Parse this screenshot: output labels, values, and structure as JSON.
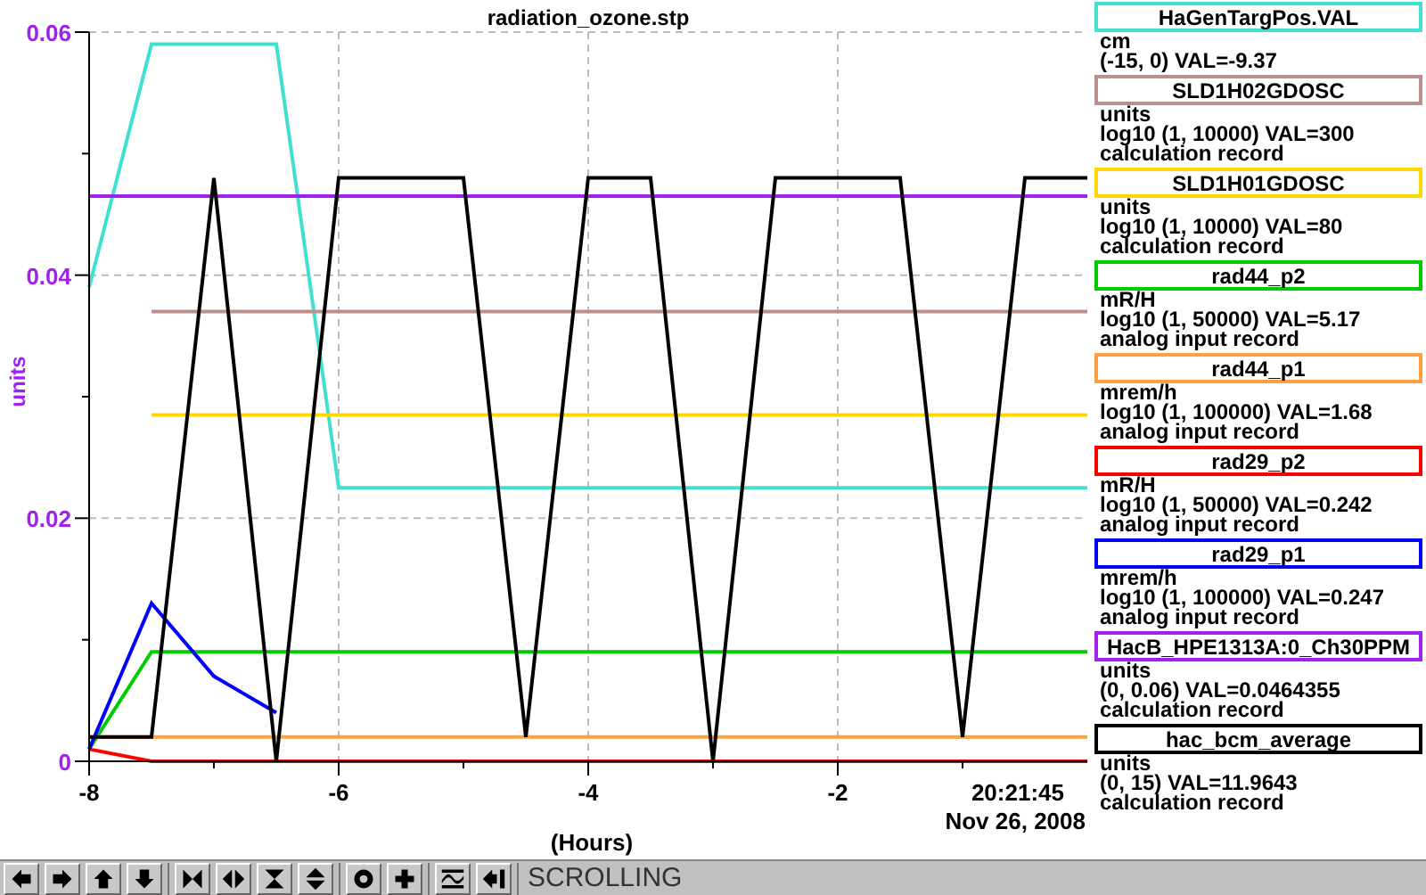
{
  "plot": {
    "time_label": "20:21:45",
    "date_label": "Nov 26, 2008",
    "chart_data": {
      "type": "line",
      "title": "radiation_ozone.stp",
      "xlabel": "(Hours)",
      "ylabel": "units",
      "x": [
        -8,
        -7.5,
        -7,
        -6.5,
        -6,
        -5.5,
        -5,
        -4.5,
        -4,
        -3.5,
        -3,
        -2.5,
        -2,
        -1.5,
        -1,
        -0.5,
        0
      ],
      "grid": true,
      "xlim": [
        -8,
        0
      ],
      "ylim": [
        0,
        0.06
      ],
      "xticks": [
        -8,
        -6,
        -4,
        -2
      ],
      "yticks": [
        0,
        0.02,
        0.04,
        0.06
      ],
      "series": [
        {
          "name": "HaGenTargPos.VAL",
          "color": "#40e0d0",
          "values": [
            0.039,
            0.059,
            0.059,
            0.059,
            0.0225,
            0.0225,
            0.0225,
            0.0225,
            0.0225,
            0.0225,
            0.0225,
            0.0225,
            0.0225,
            0.0225,
            0.0225,
            0.0225,
            0.0225
          ]
        },
        {
          "name": "SLD1H02GDOSC",
          "color": "#bc8f8f",
          "values": [
            null,
            0.037,
            0.037,
            0.037,
            0.037,
            0.037,
            0.037,
            0.037,
            0.037,
            0.037,
            0.037,
            0.037,
            0.037,
            0.037,
            0.037,
            0.037,
            0.037
          ]
        },
        {
          "name": "SLD1H01GDOSC",
          "color": "#ffd700",
          "values": [
            null,
            0.0285,
            0.0285,
            0.0285,
            0.0285,
            0.0285,
            0.0285,
            0.0285,
            0.0285,
            0.0285,
            0.0285,
            0.0285,
            0.0285,
            0.0285,
            0.0285,
            0.0285,
            0.0285
          ]
        },
        {
          "name": "rad44_p2",
          "color": "#00cd00",
          "values": [
            0.001,
            0.009,
            0.009,
            0.009,
            0.009,
            0.009,
            0.009,
            0.009,
            0.009,
            0.009,
            0.009,
            0.009,
            0.009,
            0.009,
            0.009,
            0.009,
            0.009
          ]
        },
        {
          "name": "rad44_p1",
          "color": "#ffa040",
          "values": [
            0.002,
            0.002,
            0.002,
            0.002,
            0.002,
            0.002,
            0.002,
            0.002,
            0.002,
            0.002,
            0.002,
            0.002,
            0.002,
            0.002,
            0.002,
            0.002,
            0.002
          ]
        },
        {
          "name": "rad29_p2",
          "color": "#ff0000",
          "values": [
            0.001,
            0,
            0,
            0,
            0,
            0,
            0,
            0,
            0,
            0,
            0,
            0,
            0,
            0,
            0,
            0,
            0
          ]
        },
        {
          "name": "rad29_p1",
          "color": "#0000ff",
          "values": [
            0.001,
            0.013,
            0.007,
            0.004,
            null,
            null,
            null,
            null,
            null,
            null,
            null,
            null,
            null,
            null,
            null,
            null,
            null
          ]
        },
        {
          "name": "HacB_HPE1313A:0_Ch30PPM",
          "color": "#a020f0",
          "values": [
            0.0465,
            0.0465,
            0.0465,
            0.0465,
            0.0465,
            0.0465,
            0.0465,
            0.0465,
            0.0465,
            0.0465,
            0.0465,
            0.0465,
            0.0465,
            0.0465,
            0.0465,
            0.0465,
            0.0465
          ]
        },
        {
          "name": "hac_bcm_average",
          "color": "#000000",
          "values": [
            0.002,
            0.002,
            0.048,
            0,
            0.048,
            0.048,
            0.048,
            0.002,
            0.048,
            0.048,
            0,
            0.048,
            0.048,
            0.048,
            0.002,
            0.048,
            0.048
          ]
        }
      ]
    }
  },
  "legend": [
    {
      "lines": [
        "cm",
        "(-15, 0) VAL=-9.37"
      ]
    },
    {
      "lines": [
        "units",
        "log10 (1, 10000) VAL=300",
        "calculation record"
      ]
    },
    {
      "lines": [
        "units",
        "log10 (1, 10000) VAL=80",
        "calculation record"
      ]
    },
    {
      "lines": [
        "mR/H",
        "log10 (1, 50000) VAL=5.17",
        "analog input record"
      ]
    },
    {
      "lines": [
        "mrem/h",
        "log10 (1, 100000) VAL=1.68",
        "analog input record"
      ]
    },
    {
      "lines": [
        "mR/H",
        "log10 (1, 50000) VAL=0.242",
        "analog input record"
      ]
    },
    {
      "lines": [
        "mrem/h",
        "log10 (1, 100000) VAL=0.247",
        "analog input record"
      ]
    },
    {
      "lines": [
        "units",
        "(0, 0.06) VAL=0.0464355",
        "calculation record"
      ]
    },
    {
      "lines": [
        "units",
        "(0, 15) VAL=11.9643",
        "calculation record"
      ]
    }
  ],
  "toolbar": {
    "mode": "SCROLLING"
  }
}
